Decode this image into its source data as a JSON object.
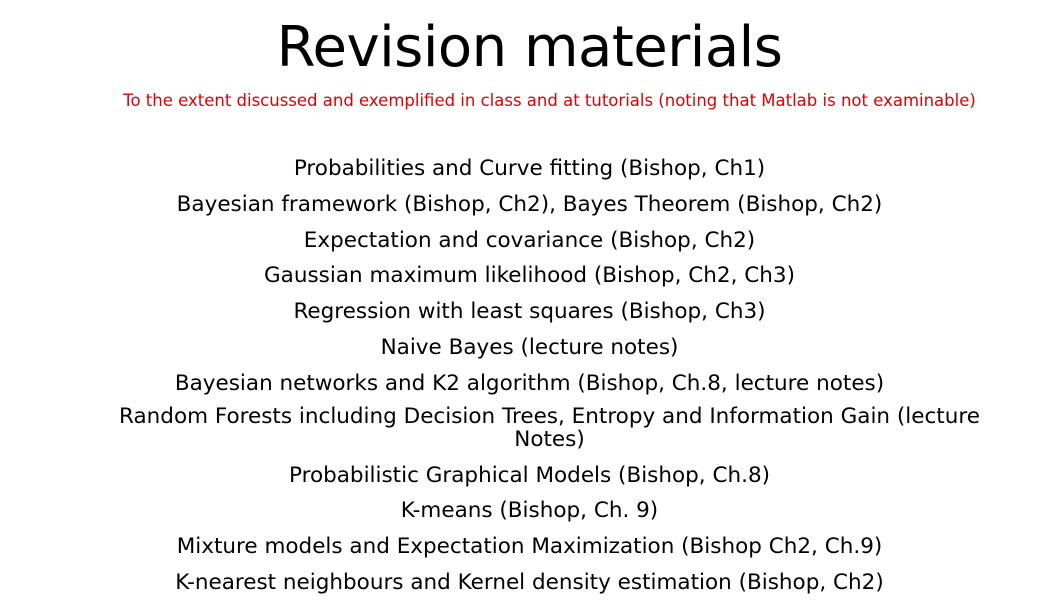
{
  "slide": {
    "title": "Revision materials",
    "subtitle": "To the extent discussed and exemplified in class and at tutorials (noting that Matlab is not examinable)",
    "subtitle_color": "#e00000",
    "topics": [
      "Probabilities and Curve fitting (Bishop, Ch1)",
      "Bayesian framework (Bishop, Ch2), Bayes Theorem (Bishop, Ch2)",
      "Expectation and covariance (Bishop, Ch2)",
      "Gaussian maximum likelihood (Bishop, Ch2, Ch3)",
      "Regression with least squares (Bishop, Ch3)",
      "Naive Bayes (lecture notes)",
      "Bayesian networks and K2 algorithm (Bishop, Ch.8, lecture notes)",
      "Random Forests including Decision Trees, Entropy and Information Gain (lecture Notes)",
      "Probabilistic Graphical Models (Bishop, Ch.8)",
      "K-means (Bishop, Ch. 9)",
      "Mixture models and Expectation Maximization (Bishop Ch2, Ch.9)",
      "K-nearest neighbours and Kernel density estimation (Bishop, Ch2)"
    ]
  }
}
